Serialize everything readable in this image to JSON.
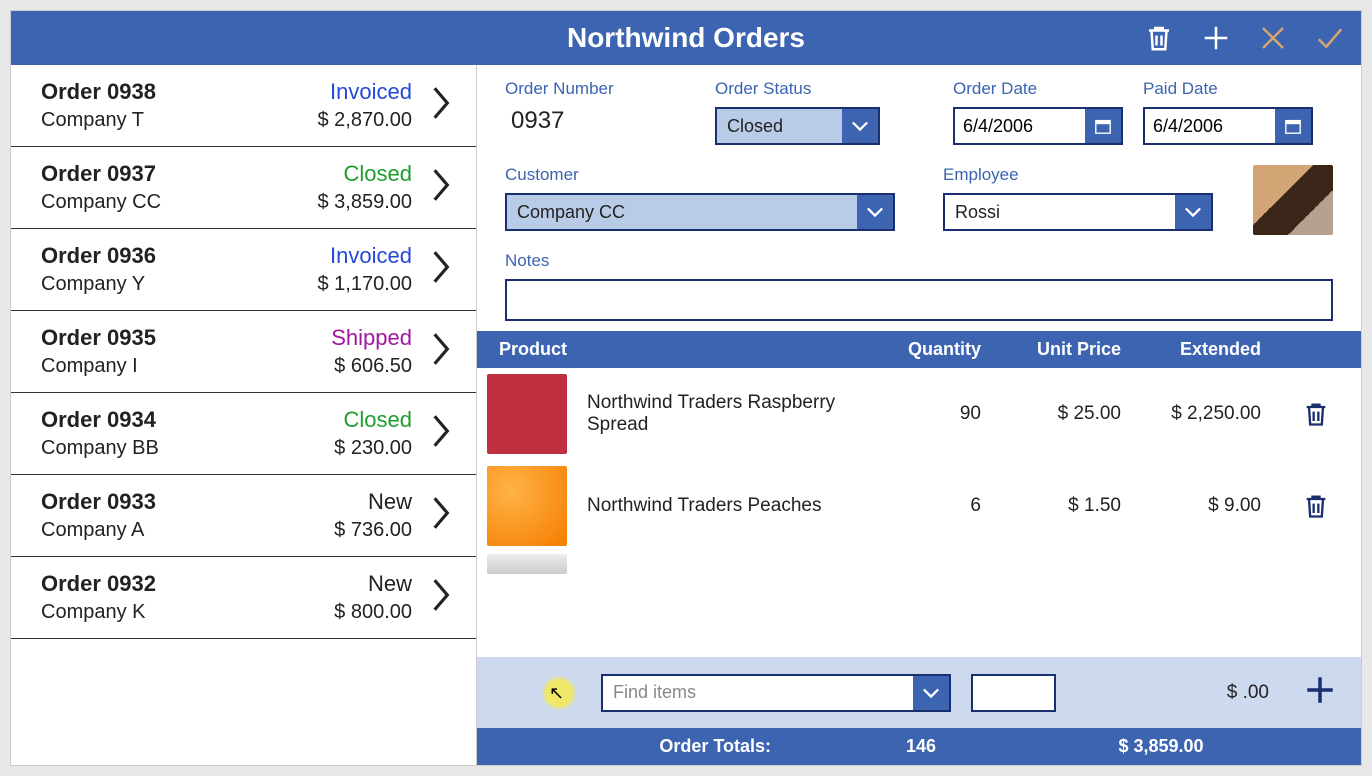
{
  "title": "Northwind Orders",
  "sidebar": {
    "orders": [
      {
        "id": "Order 0938",
        "company": "Company T",
        "status": "Invoiced",
        "amount": "$ 2,870.00"
      },
      {
        "id": "Order 0937",
        "company": "Company CC",
        "status": "Closed",
        "amount": "$ 3,859.00"
      },
      {
        "id": "Order 0936",
        "company": "Company Y",
        "status": "Invoiced",
        "amount": "$ 1,170.00"
      },
      {
        "id": "Order 0935",
        "company": "Company I",
        "status": "Shipped",
        "amount": "$ 606.50"
      },
      {
        "id": "Order 0934",
        "company": "Company BB",
        "status": "Closed",
        "amount": "$ 230.00"
      },
      {
        "id": "Order 0933",
        "company": "Company A",
        "status": "New",
        "amount": "$ 736.00"
      },
      {
        "id": "Order 0932",
        "company": "Company K",
        "status": "New",
        "amount": "$ 800.00"
      }
    ]
  },
  "form": {
    "order_number_label": "Order Number",
    "order_number": "0937",
    "order_status_label": "Order Status",
    "order_status": "Closed",
    "order_date_label": "Order Date",
    "order_date": "6/4/2006",
    "paid_date_label": "Paid Date",
    "paid_date": "6/4/2006",
    "customer_label": "Customer",
    "customer": "Company CC",
    "employee_label": "Employee",
    "employee": "Rossi",
    "notes_label": "Notes",
    "notes": ""
  },
  "items_header": {
    "product": "Product",
    "quantity": "Quantity",
    "unit_price": "Unit Price",
    "extended": "Extended"
  },
  "line_items": [
    {
      "name": "Northwind Traders Raspberry Spread",
      "qty": "90",
      "unit_price": "$ 25.00",
      "extended": "$ 2,250.00"
    },
    {
      "name": "Northwind Traders Peaches",
      "qty": "6",
      "unit_price": "$ 1.50",
      "extended": "$ 9.00"
    }
  ],
  "add_bar": {
    "find_placeholder": "Find items",
    "new_price": "$ .00"
  },
  "totals": {
    "label": "Order Totals:",
    "qty": "146",
    "amount": "$ 3,859.00"
  }
}
